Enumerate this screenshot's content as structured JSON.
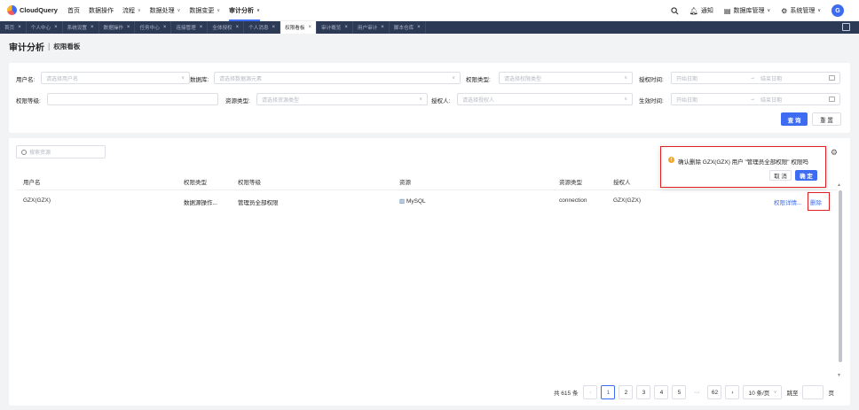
{
  "app": {
    "name": "CloudQuery"
  },
  "nav": {
    "items": [
      {
        "label": "首页",
        "chev": false,
        "active": false
      },
      {
        "label": "数据操作",
        "chev": false,
        "active": false
      },
      {
        "label": "流程",
        "chev": true,
        "active": false
      },
      {
        "label": "数据处理",
        "chev": true,
        "active": false
      },
      {
        "label": "数据变更",
        "chev": true,
        "active": false
      },
      {
        "label": "审计分析",
        "chev": true,
        "active": true
      }
    ],
    "right": {
      "notify": "通知",
      "db_manage": "数据库管理",
      "sys_manage": "系统管理",
      "avatar": "G"
    }
  },
  "tabs": [
    {
      "label": "首页",
      "active": false
    },
    {
      "label": "个人中心",
      "active": false
    },
    {
      "label": "系统设置",
      "active": false
    },
    {
      "label": "数据操作",
      "active": false
    },
    {
      "label": "任务中心",
      "active": false
    },
    {
      "label": "连接管理",
      "active": false
    },
    {
      "label": "全体授权",
      "active": false
    },
    {
      "label": "个人消息",
      "active": false
    },
    {
      "label": "权限看板",
      "active": true
    },
    {
      "label": "审计概览",
      "active": false
    },
    {
      "label": "用户审计",
      "active": false
    },
    {
      "label": "脚本仓库",
      "active": false
    }
  ],
  "page": {
    "title": "审计分析",
    "subtitle": "权限看板"
  },
  "filters": {
    "user_label": "用户名:",
    "user_ph": "请选择用户名",
    "db_label": "数据库:",
    "db_ph": "请选择数据源元素",
    "perm_type_label": "权限类型:",
    "perm_type_ph": "请选择权限类型",
    "grant_time_label": "授权时间:",
    "start_ph": "开始日期",
    "end_ph": "结束日期",
    "arrow": "→",
    "perm_level_label": "权限等级:",
    "res_type_label": "资源类型:",
    "res_type_ph": "请选择资源类型",
    "grantor_label": "授权人:",
    "grantor_ph": "请选择授权人",
    "effect_time_label": "生效时间:",
    "query_btn": "查 询",
    "reset_btn": "重 置"
  },
  "table": {
    "search_ph": "搜索资源",
    "columns": [
      "用户名",
      "权限类型",
      "权限等级",
      "资源",
      "资源类型",
      "授权人"
    ],
    "rows": [
      {
        "user": "GZX(GZX)",
        "perm_type": "数据源操作...",
        "perm_level": "管理员全部权限",
        "resource": "MySQL",
        "res_type": "connection",
        "grantor": "GZX(GZX)",
        "detail": "权限详情...",
        "delete": "删除"
      }
    ]
  },
  "popconfirm": {
    "message": "确认删除 GZX(GZX) 用户 \"管理员全部权限\" 权限吗",
    "cancel": "取 消",
    "ok": "确 定"
  },
  "pagination": {
    "total": "共 615 条",
    "pages": [
      "1",
      "2",
      "3",
      "4",
      "5"
    ],
    "dots": "···",
    "last": "62",
    "current": "1",
    "page_size": "10 条/页",
    "jump": "跳至",
    "page_unit": "页"
  },
  "colors": {
    "accent": "#3d6cf2",
    "tabbar": "#2d3a55",
    "highlight": "#e02020",
    "warn": "#f5a623"
  }
}
